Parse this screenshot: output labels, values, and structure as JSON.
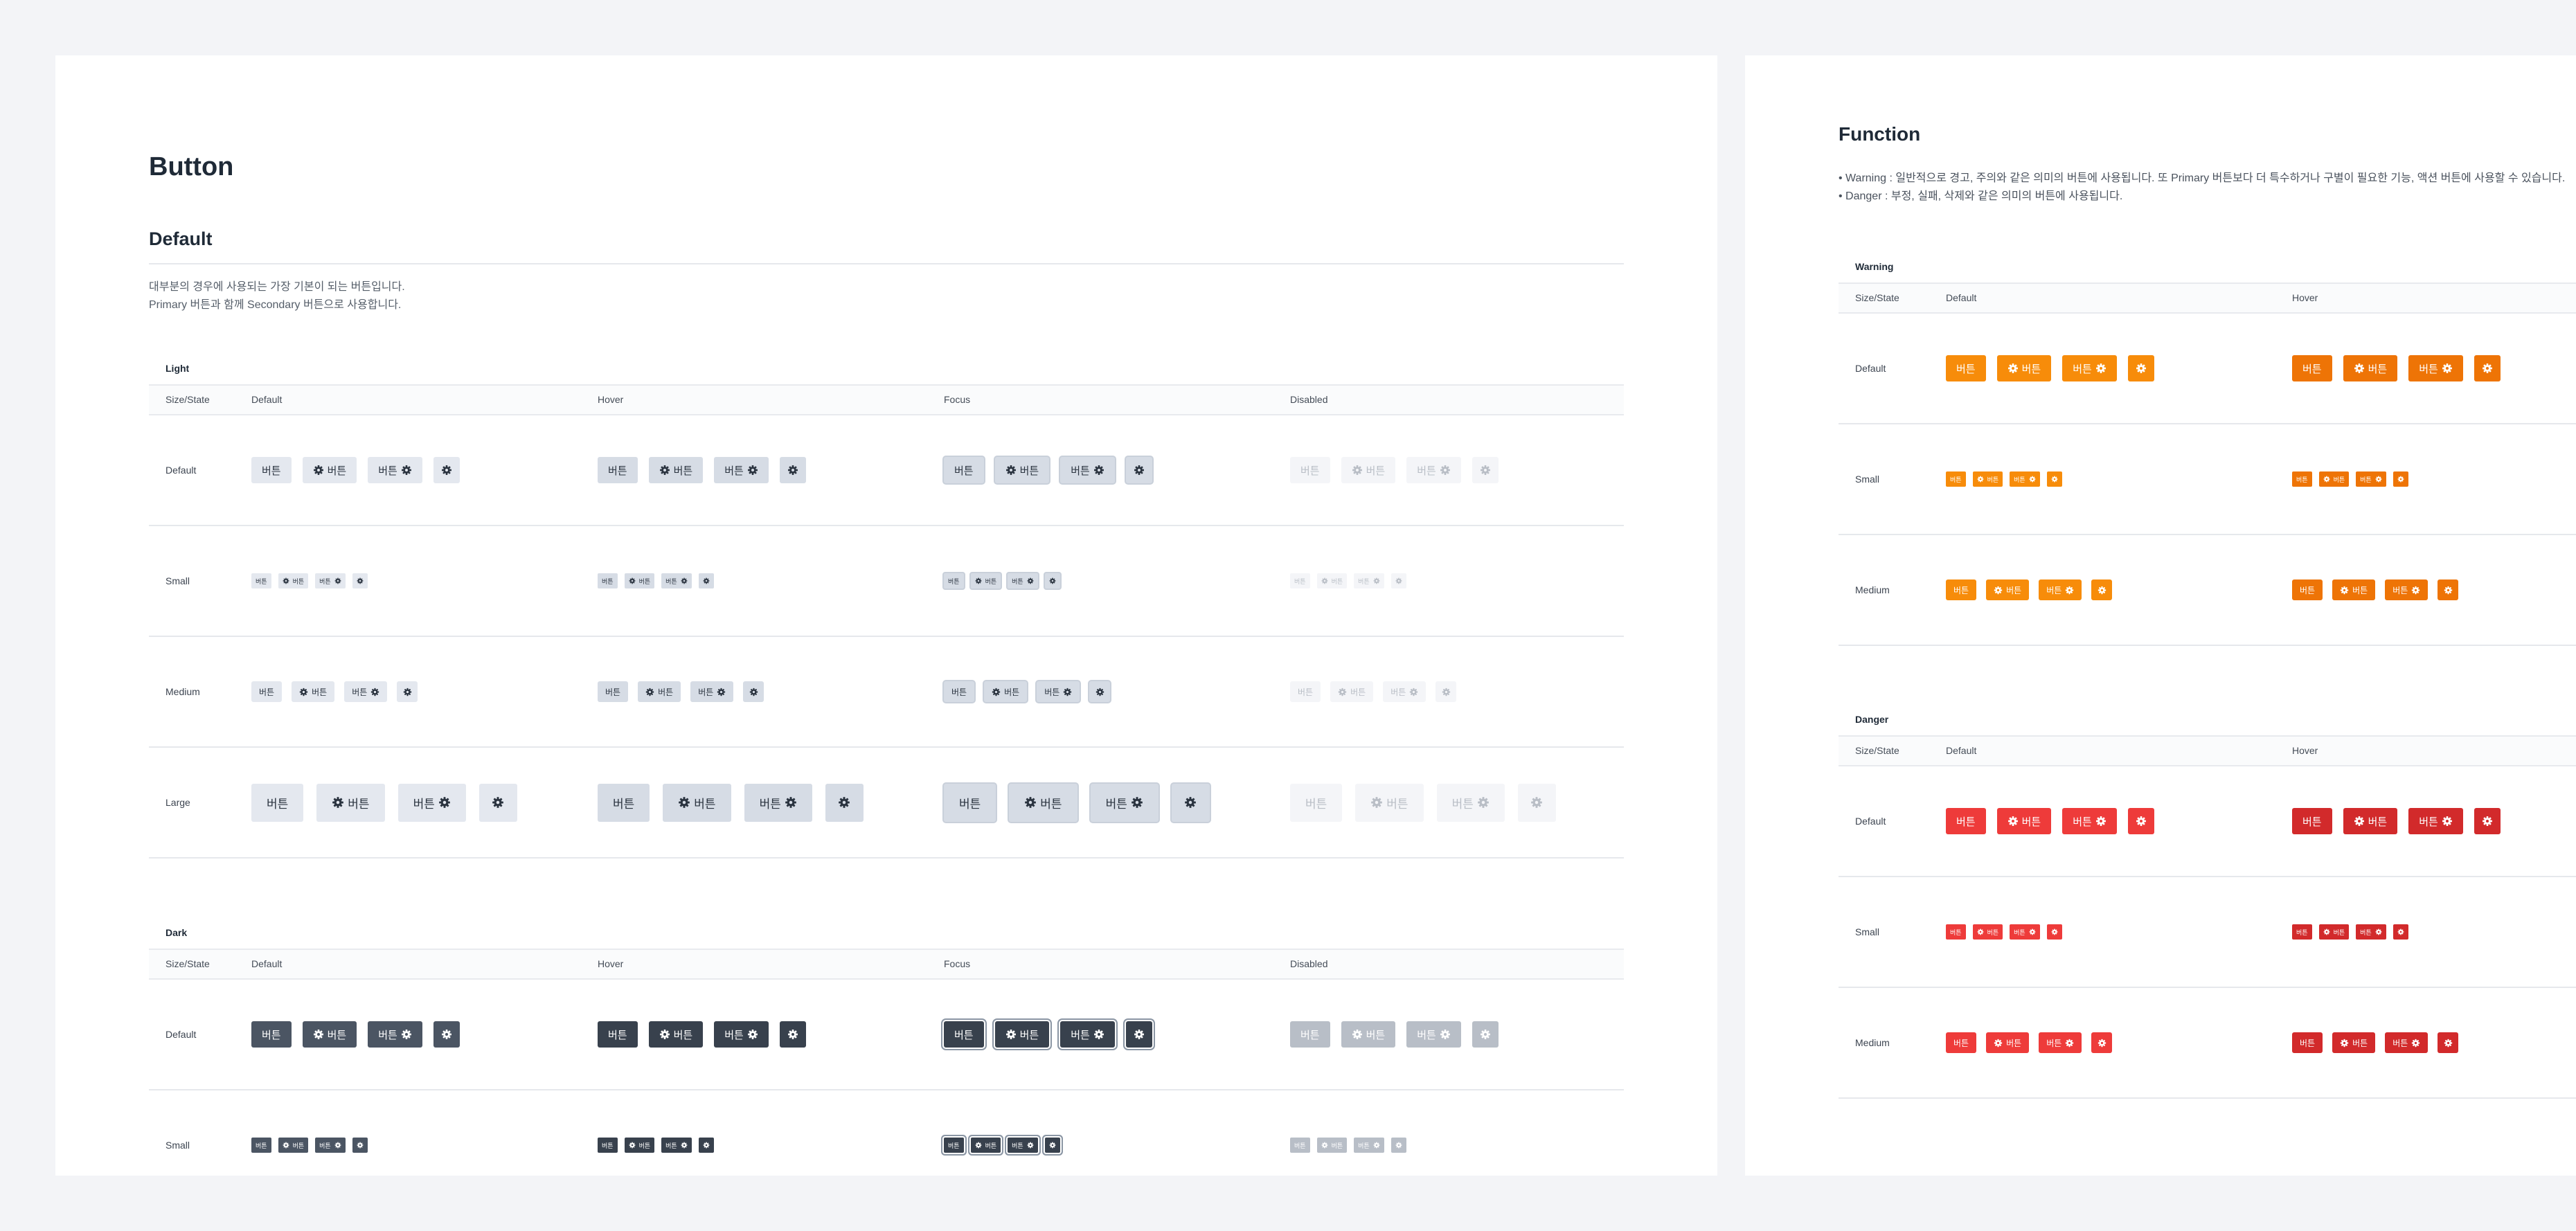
{
  "page": {
    "title": "Button"
  },
  "default_section": {
    "title": "Default",
    "desc_1": "대부분의 경우에 사용되는 가장 기본이 되는 버튼입니다.",
    "desc_2": "Primary 버튼과 함께 Secondary 버튼으로 사용합니다."
  },
  "common": {
    "btn_label": "버튼",
    "gear_icon": "gear-icon",
    "col_sizestate": "Size/State",
    "col_default": "Default",
    "col_hover": "Hover",
    "col_focus": "Focus",
    "col_disabled": "Disabled",
    "row_default": "Default",
    "row_small": "Small",
    "row_medium": "Medium",
    "row_large": "Large"
  },
  "tables": {
    "light": "Light",
    "dark": "Dark",
    "warning": "Warning",
    "danger": "Danger"
  },
  "function_section": {
    "title": "Function",
    "bullet_1": "Warning : 일반적으로 경고, 주의와 같은 의미의 버튼에 사용됩니다. 또 Primary 버튼보다 더 특수하거나 구별이 필요한 기능, 액션 버튼에 사용할 수 있습니다.",
    "bullet_2": "Danger : 부정, 실패, 삭제와 같은 의미의 버튼에 사용됩니다."
  },
  "colors": {
    "light_default": "#e4e8ef",
    "dark_default": "#4b5563",
    "warning": "#f78c0a",
    "warning_hover": "#ee7406",
    "danger": "#ee3b3a",
    "danger_hover": "#d22a2b"
  }
}
